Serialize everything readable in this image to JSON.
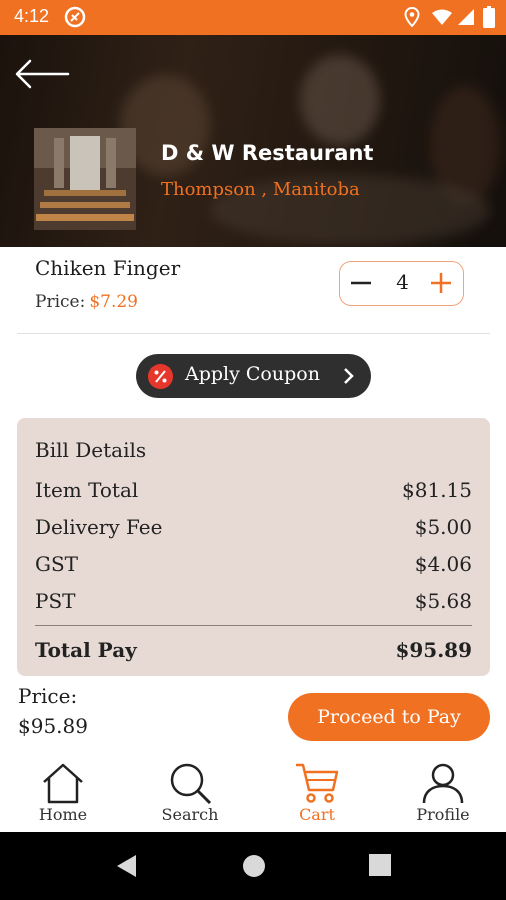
{
  "status_bar": {
    "time": "4:12"
  },
  "restaurant": {
    "name": "D & W Restaurant",
    "location": "Thompson , Manitoba"
  },
  "cart_item": {
    "name": "Chiken Finger",
    "price_label": "Price:",
    "price": "$7.29",
    "quantity": "4"
  },
  "coupon": {
    "label": "Apply Coupon"
  },
  "bill": {
    "title": "Bill Details",
    "rows": [
      {
        "label": "Item Total",
        "value": "$81.15"
      },
      {
        "label": "Delivery Fee",
        "value": "$5.00"
      },
      {
        "label": "GST",
        "value": "$4.06"
      },
      {
        "label": "PST",
        "value": "$5.68"
      }
    ],
    "total": {
      "label": "Total Pay",
      "value": "$95.89"
    }
  },
  "footer": {
    "price_label": "Price:",
    "price_value": "$95.89",
    "proceed_label": "Proceed to Pay"
  },
  "nav": {
    "items": [
      {
        "label": "Home",
        "icon": "home-icon"
      },
      {
        "label": "Search",
        "icon": "search-icon"
      },
      {
        "label": "Cart",
        "icon": "cart-icon",
        "active": true
      },
      {
        "label": "Profile",
        "icon": "profile-icon"
      }
    ]
  },
  "colors": {
    "accent": "#f07122",
    "bill_bg": "#e7dad4",
    "coupon_bg": "#2f2f2f"
  }
}
